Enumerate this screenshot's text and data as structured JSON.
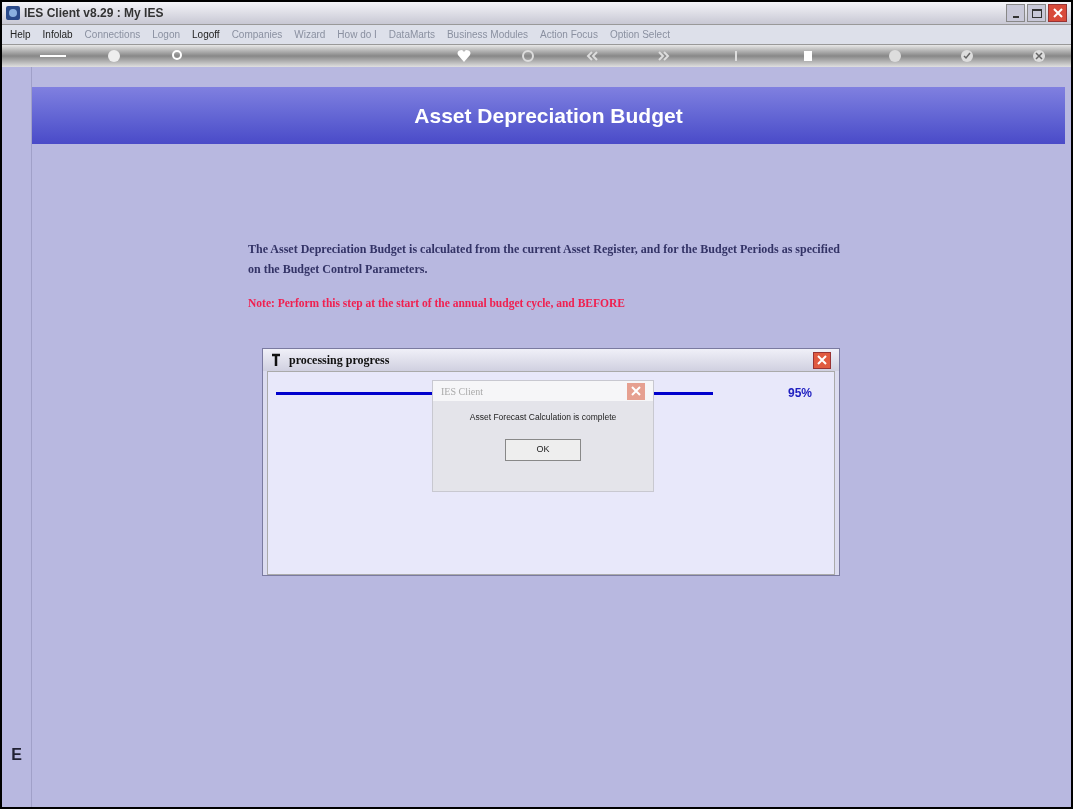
{
  "window": {
    "title": "IES Client v8.29 : My IES"
  },
  "menu": [
    {
      "label": "Help",
      "disabled": false
    },
    {
      "label": "Infolab",
      "disabled": false
    },
    {
      "label": "Connections",
      "disabled": true
    },
    {
      "label": "Logon",
      "disabled": true
    },
    {
      "label": "Logoff",
      "disabled": false
    },
    {
      "label": "Companies",
      "disabled": true
    },
    {
      "label": "Wizard",
      "disabled": true
    },
    {
      "label": "How do I",
      "disabled": true
    },
    {
      "label": "DataMarts",
      "disabled": true
    },
    {
      "label": "Business Modules",
      "disabled": true
    },
    {
      "label": "Action Focus",
      "disabled": true
    },
    {
      "label": "Option Select",
      "disabled": true
    }
  ],
  "page": {
    "title": "Asset Depreciation Budget",
    "description": "The Asset Depreciation Budget is calculated  from the current Asset Register, and for the Budget Periods as specified on the  Budget Control Parameters.",
    "note": "Note: Perform this step at the start of the    annual budget cycle, and BEFORE"
  },
  "side_tab": {
    "label": "E"
  },
  "progress_dialog": {
    "title": "processing progress",
    "level": 0.95,
    "reading": "95%"
  },
  "message_box": {
    "title": "IES Client",
    "message": "Asset Forecast Calculation is complete",
    "button": "OK"
  }
}
